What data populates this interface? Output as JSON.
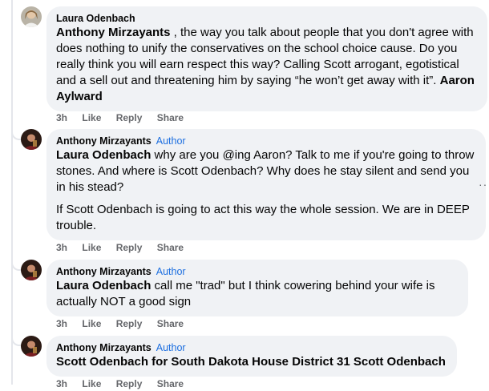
{
  "comments": [
    {
      "author": "Laura Odenbach",
      "badge": "",
      "paragraphs": [
        [
          {
            "mention": true,
            "text": "Anthony Mirzayants"
          },
          {
            "mention": false,
            "text": " , the way you talk about people that you don't agree with does nothing to unify the conservatives on the school choice cause. Do you really think you will earn respect this way? Calling Scott arrogant, egotistical and a sell out and threatening him by saying “he won’t get away with it”. "
          },
          {
            "mention": true,
            "text": "Aaron Aylward"
          }
        ]
      ],
      "time": "3h",
      "like": "Like",
      "reply": "Reply",
      "share": "Share"
    },
    {
      "author": "Anthony Mirzayants",
      "badge": "Author",
      "paragraphs": [
        [
          {
            "mention": true,
            "text": "Laura Odenbach"
          },
          {
            "mention": false,
            "text": " why are you @ing Aaron? Talk to me if you're going to throw stones. And where is Scott Odenbach? Why does he stay silent and send you in his stead?"
          }
        ],
        [
          {
            "mention": false,
            "text": "If Scott Odenbach is going to act this way the whole session. We are in DEEP trouble."
          }
        ]
      ],
      "time": "3h",
      "like": "Like",
      "reply": "Reply",
      "share": "Share"
    },
    {
      "author": "Anthony Mirzayants",
      "badge": "Author",
      "paragraphs": [
        [
          {
            "mention": true,
            "text": "Laura Odenbach"
          },
          {
            "mention": false,
            "text": " call me \"trad\" but I think cowering behind your wife is actually NOT a good sign"
          }
        ]
      ],
      "time": "3h",
      "like": "Like",
      "reply": "Reply",
      "share": "Share"
    },
    {
      "author": "Anthony Mirzayants",
      "badge": "Author",
      "paragraphs": [
        [
          {
            "mention": true,
            "text": "Scott Odenbach for South Dakota House District 31 Scott Odenbach"
          }
        ]
      ],
      "time": "3h",
      "like": "Like",
      "reply": "Reply",
      "share": "Share"
    }
  ],
  "more_options": "··",
  "colors": {
    "bubble": "#f0f2f5",
    "thread_line": "#e4e6eb",
    "author_badge": "#1d6fe0",
    "meta_text": "#65676b"
  },
  "icons": {
    "laura_avatar": "avatar-photo-icon",
    "anthony_avatar": "avatar-photo-icon"
  }
}
